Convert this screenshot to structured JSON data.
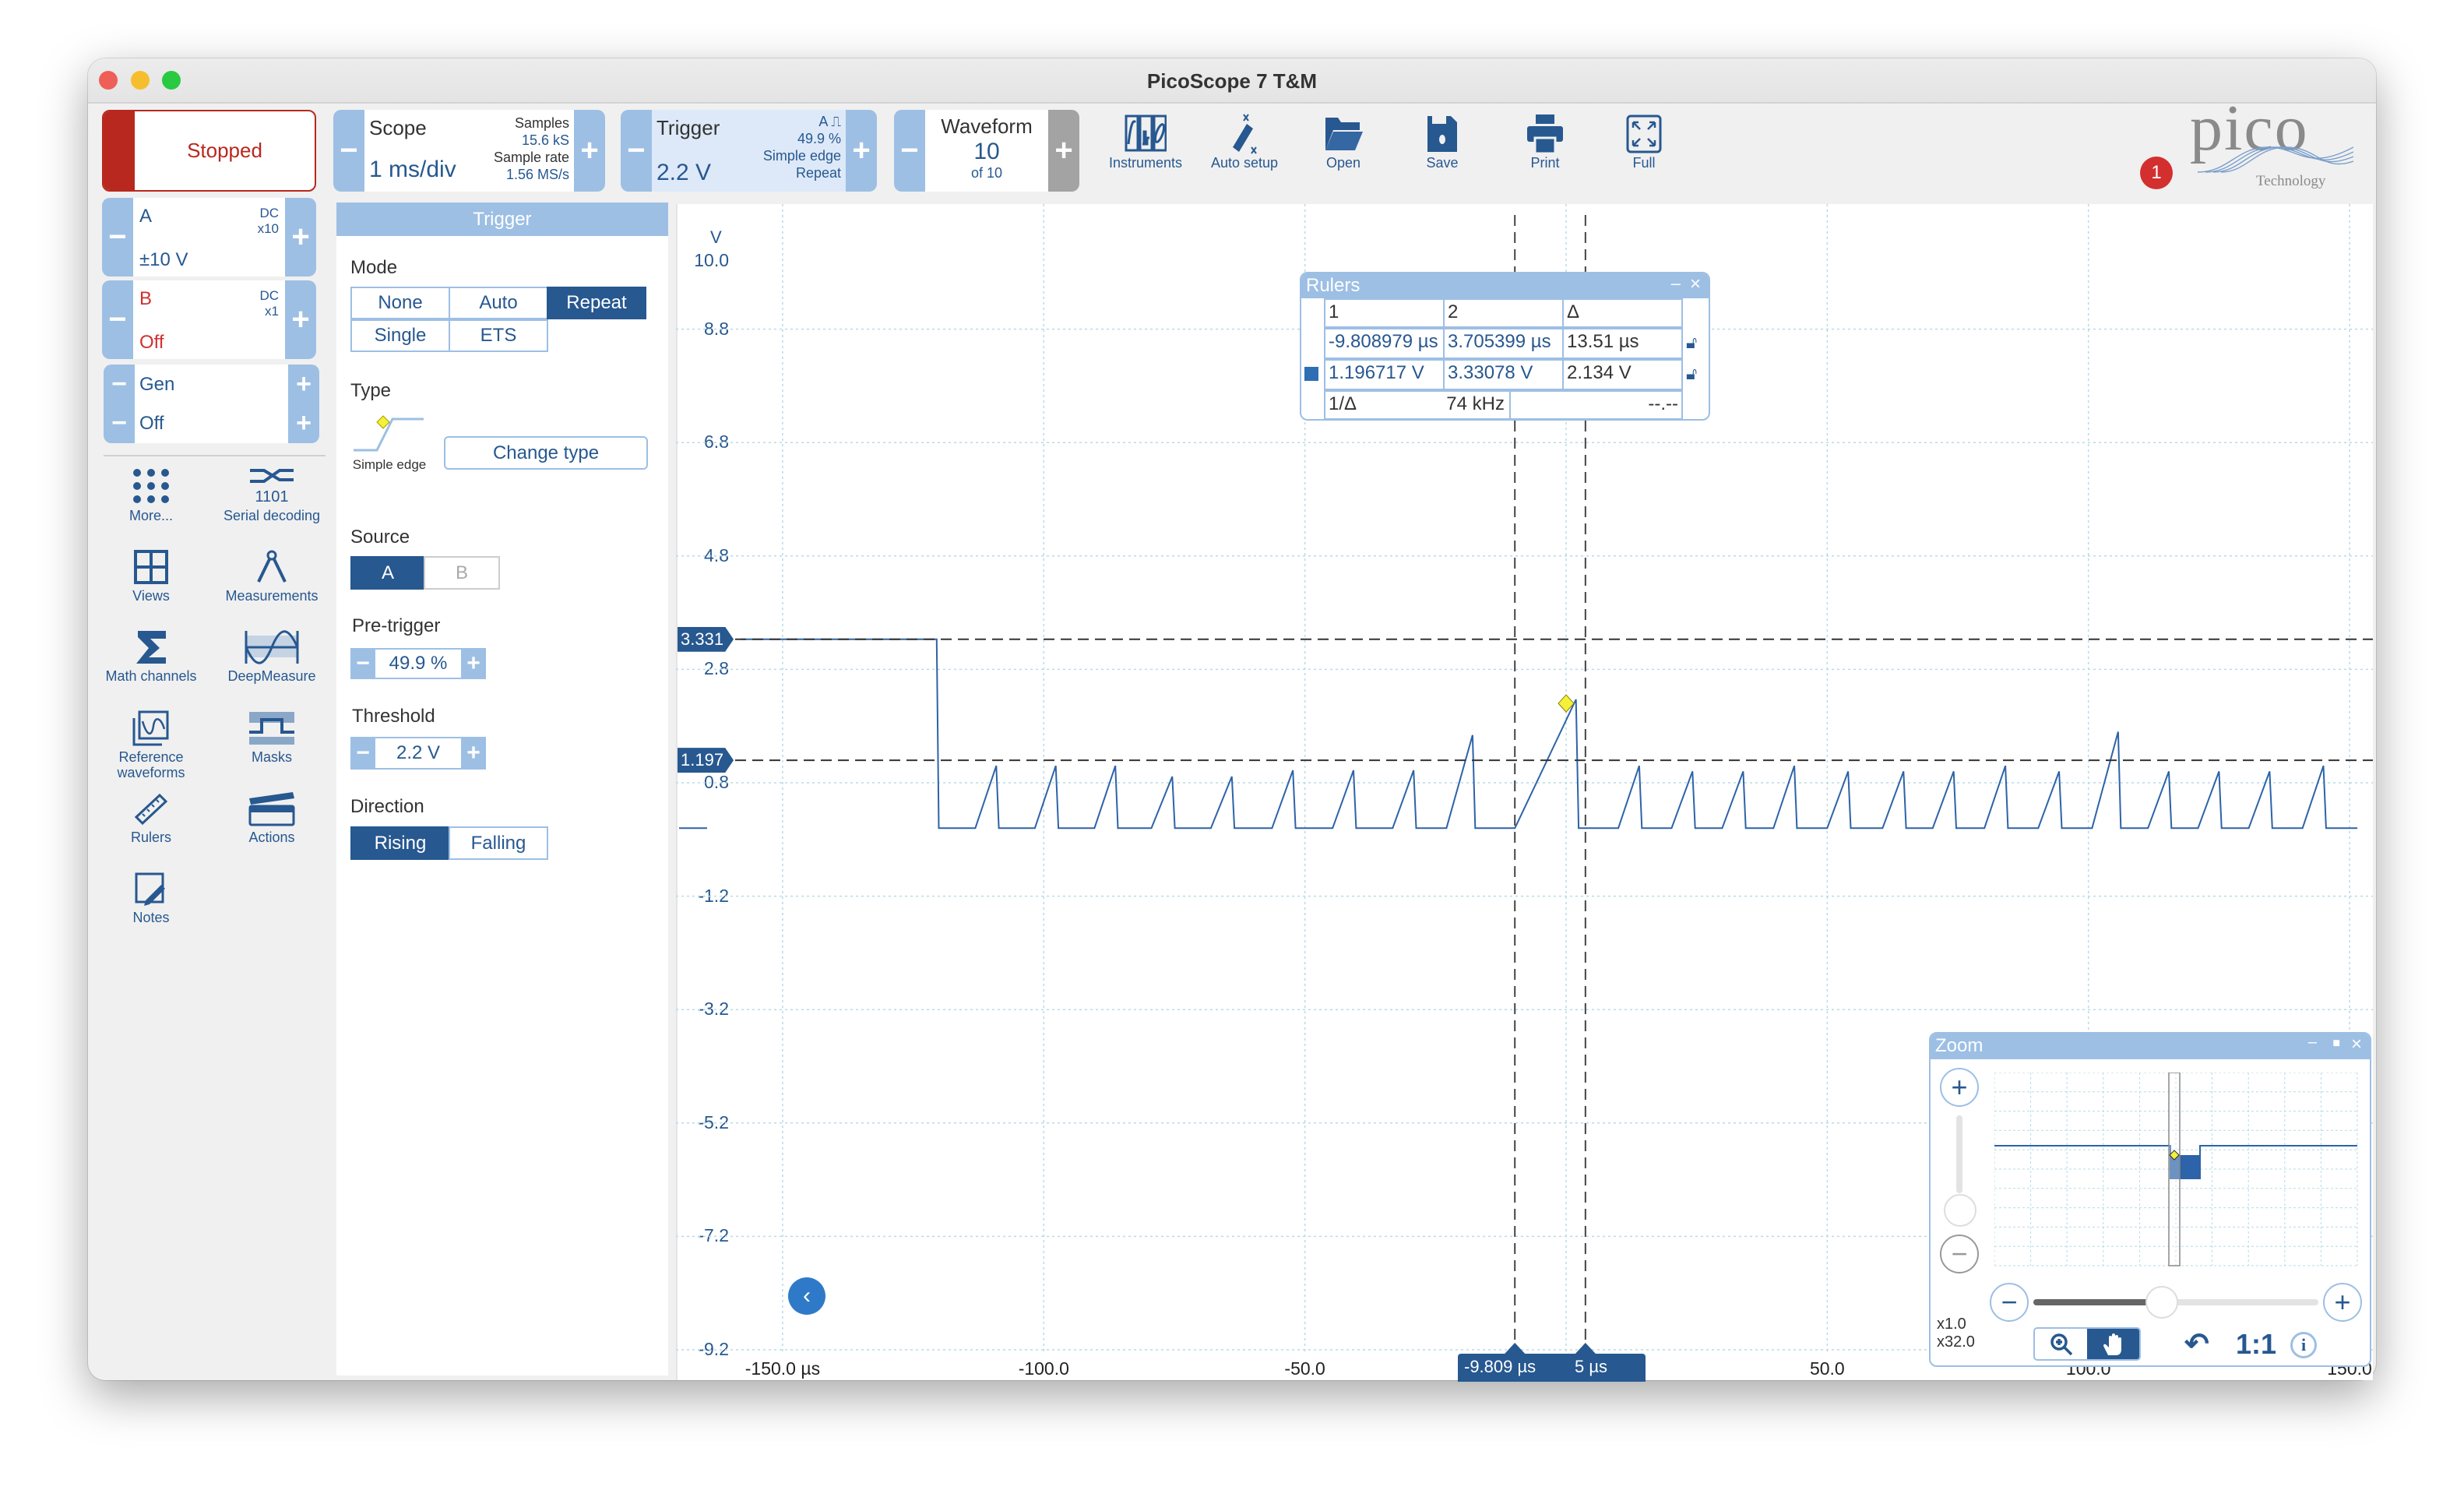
{
  "window": {
    "title": "PicoScope 7 T&M"
  },
  "glyphs": {
    "minus": "−",
    "plus": "+"
  },
  "colors": {
    "accent": "#275890",
    "light_accent": "#9dbfe4",
    "stopped": "#b8281e",
    "trace": "#2d63a8",
    "trigger_marker": "#f5f03a"
  },
  "toolbar": {
    "run_status": "Stopped",
    "scope": {
      "label": "Scope",
      "timebase": "1 ms/div",
      "samples_label": "Samples",
      "samples": "15.6 kS",
      "sample_rate_label": "Sample rate",
      "sample_rate": "1.56 MS/s"
    },
    "trigger": {
      "label": "Trigger",
      "level": "2.2 V",
      "channel": "A",
      "pretrigger": "49.9 %",
      "type": "Simple edge",
      "mode": "Repeat"
    },
    "waveform": {
      "label": "Waveform",
      "current": "10",
      "of": "of 10"
    },
    "buttons": [
      {
        "label": "Instruments",
        "icon": "instruments-icon"
      },
      {
        "label": "Auto setup",
        "icon": "auto-setup-icon"
      },
      {
        "label": "Open",
        "icon": "folder-open-icon"
      },
      {
        "label": "Save",
        "icon": "save-icon"
      },
      {
        "label": "Print",
        "icon": "printer-icon"
      },
      {
        "label": "Full",
        "icon": "fullscreen-icon"
      }
    ],
    "notification_count": "1",
    "logo": {
      "text": "pico",
      "sub": "Technology"
    }
  },
  "channels": [
    {
      "name": "A",
      "coupling": "DC",
      "probe": "x10",
      "range": "±10 V"
    },
    {
      "name": "B",
      "coupling": "DC",
      "probe": "x1",
      "range": "Off"
    }
  ],
  "generator": {
    "name": "Gen",
    "state": "Off"
  },
  "tools": [
    {
      "label": "More...",
      "icon": "more-grid-icon"
    },
    {
      "label": "Serial decoding",
      "icon": "serial-decoding-icon"
    },
    {
      "label": "Views",
      "icon": "views-icon"
    },
    {
      "label": "Measurements",
      "icon": "measurements-icon"
    },
    {
      "label": "Math channels",
      "icon": "sigma-icon"
    },
    {
      "label": "DeepMeasure",
      "icon": "deepmeasure-icon"
    },
    {
      "label": "Reference waveforms",
      "icon": "reference-waveforms-icon"
    },
    {
      "label": "Masks",
      "icon": "masks-icon"
    },
    {
      "label": "Rulers",
      "icon": "ruler-icon"
    },
    {
      "label": "Actions",
      "icon": "actions-icon"
    },
    {
      "label": "Notes",
      "icon": "notes-icon"
    }
  ],
  "trigger_panel": {
    "title": "Trigger",
    "mode_label": "Mode",
    "modes": [
      {
        "label": "None",
        "active": false
      },
      {
        "label": "Auto",
        "active": false
      },
      {
        "label": "Repeat",
        "active": true
      },
      {
        "label": "Single",
        "active": false
      },
      {
        "label": "ETS",
        "active": false
      }
    ],
    "type_label": "Type",
    "type_value": "Simple edge",
    "change_type": "Change type",
    "source_label": "Source",
    "sources": [
      {
        "label": "A",
        "active": true
      },
      {
        "label": "B",
        "active": false
      }
    ],
    "pretrigger_label": "Pre-trigger",
    "pretrigger_value": "49.9 %",
    "threshold_label": "Threshold",
    "threshold_value": "2.2 V",
    "direction_label": "Direction",
    "directions": [
      {
        "label": "Rising",
        "active": true
      },
      {
        "label": "Falling",
        "active": false
      }
    ]
  },
  "plot": {
    "y_unit": "V",
    "y_ticks": [
      "10.0",
      "8.8",
      "6.8",
      "4.8",
      "2.8",
      "0.8",
      "-1.2",
      "-3.2",
      "-5.2",
      "-7.2",
      "-9.2"
    ],
    "y_tick_values": [
      10.0,
      8.8,
      6.8,
      4.8,
      2.8,
      0.8,
      -1.2,
      -3.2,
      -5.2,
      -7.2,
      -9.2
    ],
    "x_ticks": [
      {
        "t": -150,
        "label": "-150.0 µs"
      },
      {
        "t": -100,
        "label": "-100.0"
      },
      {
        "t": -50,
        "label": "-50.0"
      },
      {
        "t": 50,
        "label": "50.0"
      },
      {
        "t": 100,
        "label": "100.0"
      },
      {
        "t": 150,
        "label": "150.0"
      }
    ],
    "x_grid": [
      -150,
      -100,
      -50,
      0,
      50,
      100,
      150
    ],
    "ruler_h": [
      {
        "value": 3.331,
        "label": "3.331"
      },
      {
        "value": 1.197,
        "label": "1.197"
      }
    ],
    "ruler_v": [
      {
        "t": -9.809,
        "label": "-9.809 µs"
      },
      {
        "t": 3.705,
        "label": "5 µs"
      }
    ],
    "trigger_point": {
      "t": 0,
      "v": 2.2
    },
    "trace": {
      "high_level": 3.33,
      "low_level": 0.0,
      "start_t": -158,
      "fall_t": -120.5,
      "end_t": 151.5,
      "pulses": [
        {
          "t": -109.1,
          "v": 1.1,
          "rise": 4
        },
        {
          "t": -97.7,
          "v": 1.1,
          "rise": 4
        },
        {
          "t": -86.3,
          "v": 1.1,
          "rise": 4
        },
        {
          "t": -75.4,
          "v": 0.91,
          "rise": 4
        },
        {
          "t": -64.0,
          "v": 0.91,
          "rise": 4
        },
        {
          "t": -52.3,
          "v": 1.02,
          "rise": 4
        },
        {
          "t": -40.7,
          "v": 1.02,
          "rise": 4
        },
        {
          "t": -29.2,
          "v": 1.02,
          "rise": 4
        },
        {
          "t": -17.9,
          "v": 1.64,
          "rise": 5
        },
        {
          "t": 1.9,
          "v": 2.27,
          "rise": 11.7
        },
        {
          "t": 14.0,
          "v": 1.1,
          "rise": 4
        },
        {
          "t": 24.2,
          "v": 1.0,
          "rise": 4
        },
        {
          "t": 33.9,
          "v": 1.0,
          "rise": 4
        },
        {
          "t": 43.7,
          "v": 1.1,
          "rise": 4
        },
        {
          "t": 54.0,
          "v": 1.0,
          "rise": 4
        },
        {
          "t": 64.6,
          "v": 1.0,
          "rise": 4
        },
        {
          "t": 74.2,
          "v": 1.0,
          "rise": 4
        },
        {
          "t": 84.1,
          "v": 1.1,
          "rise": 4
        },
        {
          "t": 94.4,
          "v": 1.0,
          "rise": 4
        },
        {
          "t": 105.7,
          "v": 1.7,
          "rise": 5
        },
        {
          "t": 115.4,
          "v": 1.0,
          "rise": 4
        },
        {
          "t": 125.0,
          "v": 1.0,
          "rise": 4
        },
        {
          "t": 134.7,
          "v": 1.0,
          "rise": 4
        },
        {
          "t": 145.0,
          "v": 1.1,
          "rise": 4
        }
      ]
    }
  },
  "rulers_panel": {
    "title": "Rulers",
    "headers": [
      "1",
      "2",
      "Δ"
    ],
    "time_row": [
      "-9.808979 µs",
      "3.705399 µs",
      "13.51 µs"
    ],
    "voltage_row": [
      "1.196717 V",
      "3.33078 V",
      "2.134 V"
    ],
    "freq_label": "1/Δ",
    "freq_value": "74 kHz",
    "extra_value": "--.--",
    "minimize": "–",
    "close": "×"
  },
  "zoom_panel": {
    "title": "Zoom",
    "v_zoom": "x1.0",
    "h_zoom": "x32.0",
    "one_to_one": "1:1",
    "horizontal_slider": 0.45,
    "vertical_slider": 0.0,
    "minimize": "–",
    "maximize": "■",
    "close": "×"
  }
}
